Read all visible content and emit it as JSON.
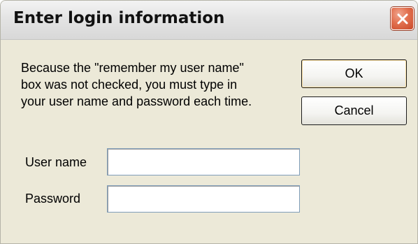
{
  "window": {
    "title": "Enter login information",
    "close_icon": "close-x-icon"
  },
  "message": {
    "lines": [
      "Because the \"remember my user name\"",
      "box was not checked, you must type in",
      "your user name and password each time."
    ]
  },
  "buttons": {
    "ok_label": "OK",
    "cancel_label": "Cancel"
  },
  "fields": {
    "user_name_label": "User name",
    "user_name_value": "",
    "password_label": "Password",
    "password_value": ""
  },
  "colors": {
    "dialog_background": "#ece9d8",
    "close_button": "#e2704f",
    "input_border": "#7f9db9"
  }
}
